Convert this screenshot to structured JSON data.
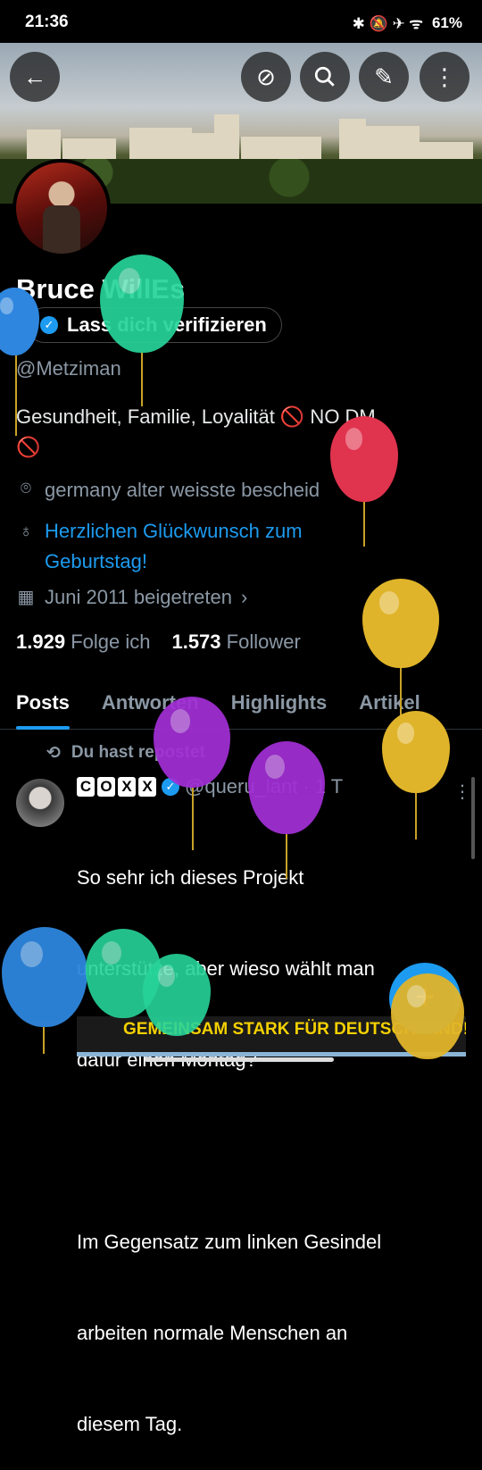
{
  "status": {
    "time": "21:36",
    "icons": "✱ 🔕 ✈ ᯤ",
    "battery": "61%"
  },
  "header": {
    "back_icon": "arrow-left-icon",
    "grok_icon": "grok-icon",
    "search_icon": "search-icon",
    "edit_icon": "pencil-icon",
    "more_icon": "more-vertical-icon"
  },
  "profile": {
    "name": "Bruce WillEs",
    "verify_label": "Lass dich verifizieren",
    "handle": "@Metziman",
    "bio_line1": "Gesundheit, Familie, Loyalität 🚫 NO DM",
    "bio_line2": "🚫",
    "location": "germany alter weisste bescheid",
    "birthday_line1": "Herzlichen Glückwunsch zum",
    "birthday_line2": "Geburtstag!",
    "joined": "Juni 2011 beigetreten",
    "following_count": "1.929",
    "following_label": "Folge ich",
    "followers_count": "1.573",
    "followers_label": "Follower"
  },
  "tabs": [
    "Posts",
    "Antworten",
    "Highlights",
    "Artikel"
  ],
  "post": {
    "repost_label": "Du hast repostet",
    "author_letters": [
      "C",
      "O",
      "X",
      "X"
    ],
    "handle": "@queru_lant",
    "time": "· 1 T",
    "text_l1": "So sehr ich dieses Projekt",
    "text_l2": "unterstütze, aber wieso wählt man",
    "text_l3": "dafür einen Montag?",
    "text_l5": "Im Gegensatz zum linken Gesindel",
    "text_l6": "arbeiten normale Menschen an",
    "text_l7": "diesem Tag.",
    "video_caption": "GEMEINSAM STARK FÜR DEUTSCHLAND!"
  },
  "fab_label": "+",
  "colors": {
    "accent": "#1d9bf0",
    "background": "#000000"
  }
}
